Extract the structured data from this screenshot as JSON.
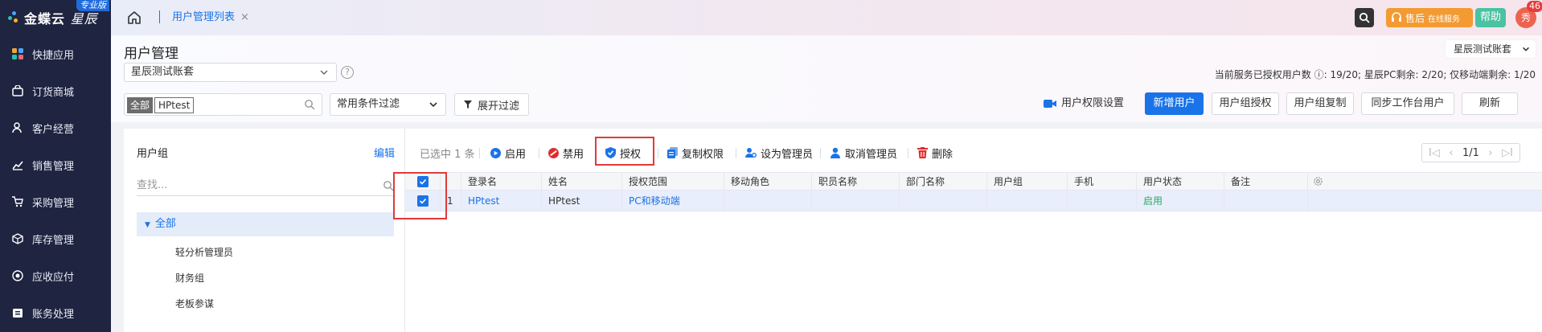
{
  "sidebar": {
    "logo_text": "金蝶云",
    "logo_sub": "星辰",
    "edition_badge": "专业版",
    "items": [
      {
        "label": "快捷应用",
        "icon": "grid-icon"
      },
      {
        "label": "订货商城",
        "icon": "bag-icon"
      },
      {
        "label": "客户经营",
        "icon": "user-icon"
      },
      {
        "label": "销售管理",
        "icon": "chart-icon"
      },
      {
        "label": "采购管理",
        "icon": "cart-icon"
      },
      {
        "label": "库存管理",
        "icon": "box-icon"
      },
      {
        "label": "应收应付",
        "icon": "money-icon"
      },
      {
        "label": "账务处理",
        "icon": "ledger-icon"
      }
    ]
  },
  "topbar": {
    "tab_label": "用户管理列表",
    "tab_close": "×",
    "service_label": "售后",
    "service_sub": "在线服务",
    "help_label": "帮助",
    "avatar_text": "秀",
    "notification_count": "46"
  },
  "header": {
    "title": "用户管理",
    "account_value": "星辰测试账套",
    "help_mark": "?",
    "account_top": "星辰测试账套",
    "usage_text": "当前服务已授权用户数 ⓘ: 19/20; 星辰PC剩余: 2/20; 仅移动端剩余: 1/20",
    "search_scope": "全部",
    "search_value": "HPtest",
    "filter_label": "常用条件过滤",
    "expand_filter": "展开过滤",
    "permission_settings": "用户权限设置",
    "buttons": {
      "add_user": "新增用户",
      "group_auth": "用户组授权",
      "group_copy": "用户组复制",
      "sync_users": "同步工作台用户",
      "refresh": "刷新"
    }
  },
  "group_panel": {
    "title": "用户组",
    "edit": "编辑",
    "search_placeholder": "查找...",
    "root": "全部",
    "children": [
      "轻分析管理员",
      "财务组",
      "老板参谋"
    ]
  },
  "toolbar": {
    "selected": "已选中 1 条",
    "enable": "启用",
    "disable": "禁用",
    "authorize": "授权",
    "copy_perm": "复制权限",
    "set_admin": "设为管理员",
    "cancel_admin": "取消管理员",
    "delete": "删除"
  },
  "pager": {
    "page": "1/1",
    "first": "I◁",
    "prev": "‹",
    "next": "›",
    "last": "▷I"
  },
  "table": {
    "columns": [
      "登录名",
      "姓名",
      "授权范围",
      "移动角色",
      "职员名称",
      "部门名称",
      "用户组",
      "手机",
      "用户状态",
      "备注"
    ],
    "rows": [
      {
        "index": "1",
        "login": "HPtest",
        "name": "HPtest",
        "scope": "PC和移动端",
        "mobile_role": "",
        "staff": "",
        "dept": "",
        "group": "",
        "phone": "",
        "status": "启用",
        "note": ""
      }
    ]
  },
  "colors": {
    "accent": "#1a73e8",
    "sidebar_bg": "#1f2440",
    "highlight_border": "#e03a3a",
    "status_green": "#2eaa5f"
  }
}
